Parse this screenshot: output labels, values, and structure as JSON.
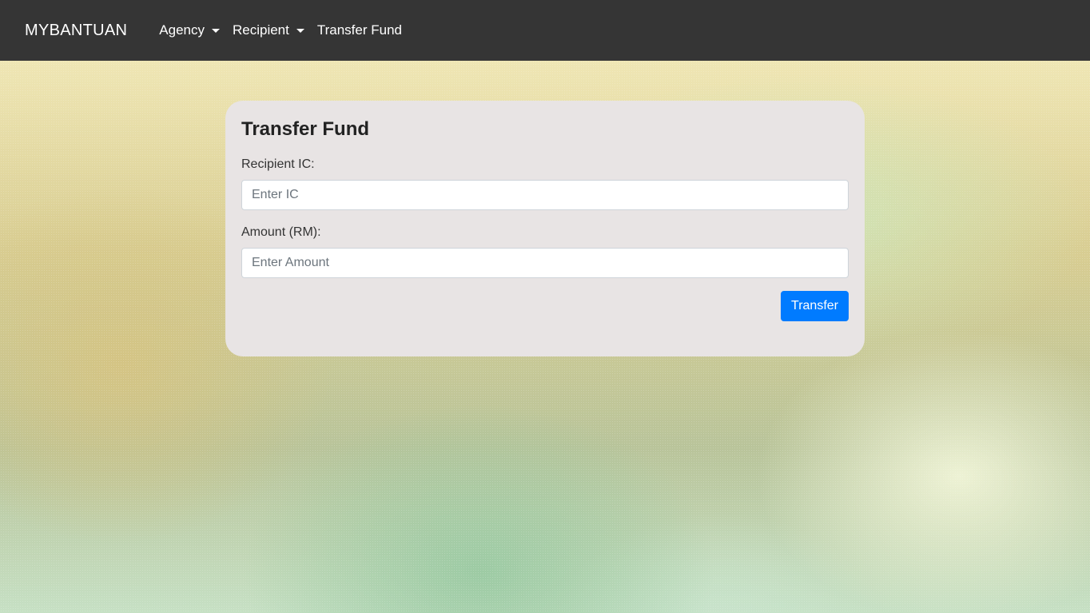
{
  "navbar": {
    "brand": "MYBANTUAN",
    "items": [
      {
        "label": "Agency",
        "dropdown": true
      },
      {
        "label": "Recipient",
        "dropdown": true
      },
      {
        "label": "Transfer Fund",
        "dropdown": false
      }
    ]
  },
  "form": {
    "title": "Transfer Fund",
    "recipient_ic": {
      "label": "Recipient IC:",
      "placeholder": "Enter IC",
      "value": ""
    },
    "amount": {
      "label": "Amount (RM):",
      "placeholder": "Enter Amount",
      "value": ""
    },
    "submit_label": "Transfer"
  },
  "colors": {
    "navbar_bg": "#353535",
    "card_bg": "#e8e4e4",
    "primary": "#007bff"
  },
  "icons": {
    "dropdown": "caret-down-icon"
  }
}
